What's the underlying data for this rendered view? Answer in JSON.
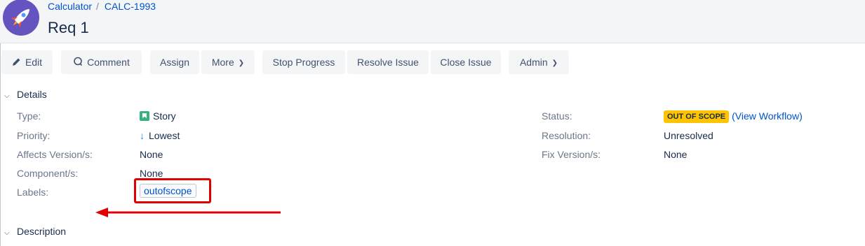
{
  "header": {
    "project_name": "Calculator",
    "separator": "/",
    "issue_key": "CALC-1993",
    "title": "Req 1"
  },
  "toolbar": {
    "edit": "Edit",
    "comment": "Comment",
    "assign": "Assign",
    "more": "More",
    "stop_progress": "Stop Progress",
    "resolve_issue": "Resolve Issue",
    "close_issue": "Close Issue",
    "admin": "Admin"
  },
  "details": {
    "heading": "Details",
    "type_label": "Type:",
    "type_value": "Story",
    "priority_label": "Priority:",
    "priority_value": "Lowest",
    "affects_label": "Affects Version/s:",
    "affects_value": "None",
    "component_label": "Component/s:",
    "component_value": "None",
    "labels_label": "Labels:",
    "labels_value": "outofscope",
    "status_label": "Status:",
    "status_value": "OUT OF SCOPE",
    "view_workflow": "(View Workflow)",
    "resolution_label": "Resolution:",
    "resolution_value": "Unresolved",
    "fix_label": "Fix Version/s:",
    "fix_value": "None"
  },
  "description": {
    "heading": "Description"
  },
  "colors": {
    "status_lozenge": "#ffc400",
    "link": "#0052cc",
    "annotation": "#e00000",
    "story_icon": "#36b37e"
  },
  "icons": [
    "rocket-avatar-icon",
    "pencil-icon",
    "comment-icon",
    "chevron-down-icon",
    "story-icon",
    "arrow-down-icon",
    "arrow-left-icon"
  ]
}
